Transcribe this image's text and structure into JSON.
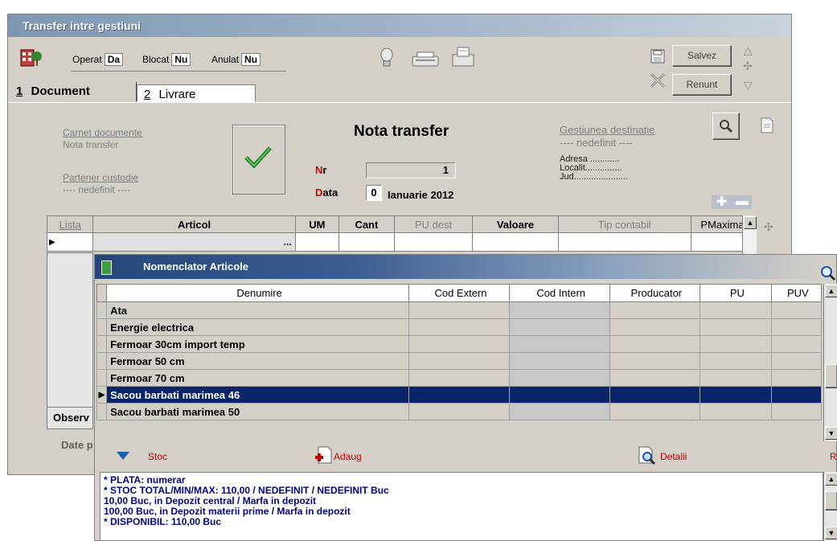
{
  "main_window": {
    "title": "Transfer intre gestiuni",
    "flags": [
      {
        "label": "Operat",
        "value": "Da"
      },
      {
        "label": "Blocat",
        "value": "Nu"
      },
      {
        "label": "Anulat",
        "value": "Nu"
      }
    ],
    "save_label": "Salvez",
    "cancel_label": "Renunt",
    "tabs": [
      {
        "num": "1",
        "label": "Document"
      },
      {
        "num": "2",
        "label": "Livrare"
      }
    ],
    "carnet_label": "Carnet documente",
    "carnet_value": "Nota transfer",
    "partener_label": "Partener custodie",
    "partener_value": "---- nedefinit ----",
    "doc_title": "Nota transfer",
    "nr_label_first": "N",
    "nr_label_rest": "r",
    "nr_value": "1",
    "data_label_first": "D",
    "data_label_rest": "ata",
    "data_day": "0",
    "data_month_year": "Ianuarie 2012",
    "gestiune_label": "Gestiunea destinatie",
    "gestiune_value": "---- nedefinit ----",
    "adresa": "Adresa ............",
    "localit": "Localit...............",
    "jud": "Jud......................",
    "grid_headers": [
      "Lista",
      "Articol",
      "UM",
      "Cant",
      "PU dest",
      "Valoare",
      "Tip contabil",
      "PMaximal"
    ],
    "grid_row_articol": "...",
    "obs_label": "Observ",
    "date_label": "Date p"
  },
  "popup": {
    "title": "Nomenclator Articole",
    "headers": [
      "Denumire",
      "Cod Extern",
      "Cod Intern",
      "Producator",
      "PU",
      "PUV"
    ],
    "rows": [
      {
        "name": "Ata",
        "selected": false
      },
      {
        "name": "Energie electrica",
        "selected": false
      },
      {
        "name": "Fermoar 30cm import temp",
        "selected": false
      },
      {
        "name": "Fermoar 50 cm",
        "selected": false
      },
      {
        "name": "Fermoar 70 cm",
        "selected": false
      },
      {
        "name": "Sacou barbati marimea 46",
        "selected": true
      },
      {
        "name": "Sacou barbati marimea 50",
        "selected": false
      }
    ],
    "toolbar": {
      "stoc": "Stoc",
      "adaug": "Adaug",
      "detalii": "Detalii",
      "r": "R"
    },
    "info_lines": [
      "* PLATA: numerar",
      "* STOC TOTAL/MIN/MAX: 110,00 / NEDEFINIT / NEDEFINIT  Buc",
      "10,00 Buc, in Depozit central / Marfa in depozit",
      "100,00 Buc, in Depozit materii prime / Marfa in depozit",
      " * DISPONIBIL: 110,00  Buc"
    ]
  },
  "colors": {
    "title_gradient_start": "#7e97b2",
    "popup_title_start": "#25467a",
    "selection": "#0a246a",
    "info_text": "#000080",
    "required_red": "#cc0000"
  },
  "icons": [
    "building-icon",
    "lightbulb-icon",
    "printer-icon",
    "fax-icon",
    "floppy-icon",
    "close-x-icon",
    "arrow-up-icon",
    "move-icon",
    "arrow-down-icon",
    "magnifier-icon",
    "document-icon",
    "check-icon",
    "plus-icon",
    "minus-icon",
    "down-triangle-icon",
    "add-doc-icon",
    "details-icon"
  ]
}
